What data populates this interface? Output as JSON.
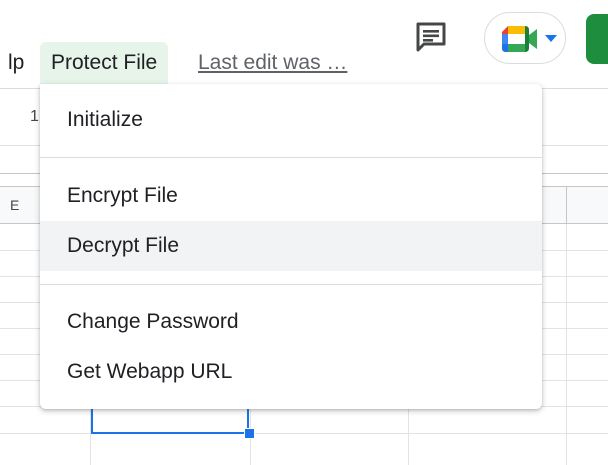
{
  "menubar": {
    "help_label": "lp",
    "protect_file_label": "Protect File",
    "last_edit_label": "Last edit was …"
  },
  "sheet": {
    "row_number": "1",
    "column_letter": "E"
  },
  "dropdown": {
    "items": [
      {
        "label": "Initialize"
      },
      {
        "label": "Encrypt File"
      },
      {
        "label": "Decrypt File"
      },
      {
        "label": "Change Password"
      },
      {
        "label": "Get Webapp URL"
      }
    ],
    "highlighted_item": "Decrypt File"
  },
  "colors": {
    "menu_active_bg": "#e6f4ea",
    "hover_bg": "#f1f3f4",
    "selection_blue": "#1a73e8",
    "share_green": "#1e8e3e",
    "text_primary": "#202124",
    "text_secondary": "#5f6368"
  },
  "icons": {
    "comment": "comment-icon",
    "meet": "google-meet-icon",
    "meet_dropdown": "caret-down-icon"
  }
}
